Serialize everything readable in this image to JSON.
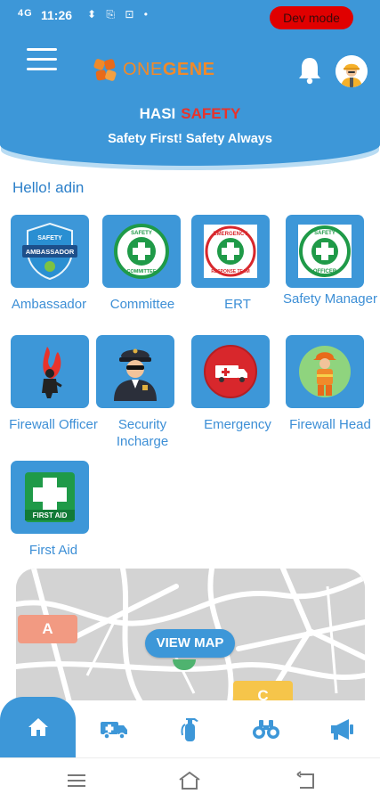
{
  "status_bar": {
    "signal": "4G",
    "time": "11:26",
    "icons": "⬍ ⎘ ⊡ •",
    "dev_mode": "Dev mode"
  },
  "header": {
    "logo_part1": "ONE",
    "logo_part2": "GENE",
    "brand_part1": "HASI",
    "brand_part2": "SAFETY",
    "tagline": "Safety First! Safety Always",
    "bell_icon": "bell-icon",
    "menu_icon": "hamburger-menu-icon"
  },
  "greeting": "Hello! adin",
  "tiles": [
    {
      "label": "Ambassador",
      "icon": "safety-ambassador-badge-icon",
      "badge_top": "SAFETY",
      "badge_text": "AMBASSADOR"
    },
    {
      "label": "Committee",
      "icon": "safety-committee-cross-icon",
      "badge_top": "SAFETY",
      "badge_text": "COMMITTEE"
    },
    {
      "label": "ERT",
      "icon": "emergency-response-team-icon",
      "badge_top": "EMERGENCY",
      "badge_text": "RESPONSE TEAM"
    },
    {
      "label": "Safety Manager",
      "icon": "safety-officer-badge-icon",
      "badge_top": "SAFETY",
      "badge_text": "OFFICER"
    },
    {
      "label": "Firewall Officer",
      "icon": "fire-officer-icon"
    },
    {
      "label": "Security Incharge",
      "icon": "security-guard-icon"
    },
    {
      "label": "Emergency",
      "icon": "ambulance-icon"
    },
    {
      "label": "Firewall Head",
      "icon": "firefighter-icon"
    },
    {
      "label": "First Aid",
      "icon": "first-aid-icon",
      "badge_text": "FIRST AID"
    }
  ],
  "map": {
    "button": "VIEW MAP",
    "marker_a": "A",
    "marker_c": "C"
  },
  "bottom_nav": [
    {
      "icon": "home-icon",
      "active": true
    },
    {
      "icon": "ambulance-icon",
      "active": false
    },
    {
      "icon": "fire-extinguisher-icon",
      "active": false
    },
    {
      "icon": "binoculars-icon",
      "active": false
    },
    {
      "icon": "megaphone-icon",
      "active": false
    }
  ],
  "colors": {
    "primary": "#3d97d8",
    "accent_red": "#e8332b",
    "logo_orange": "#f08a2a",
    "label_blue": "#3d8fd6"
  }
}
